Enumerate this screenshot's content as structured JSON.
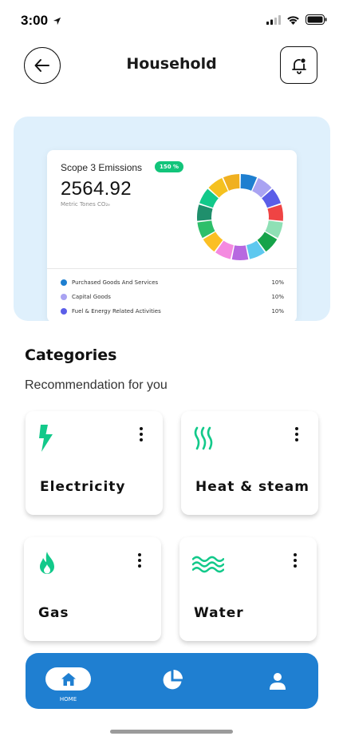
{
  "status_bar": {
    "time": "3:00"
  },
  "header": {
    "title": "Household"
  },
  "emissions": {
    "title": "Scope 3 Emissions",
    "badge": "150 %",
    "value": "2564.92",
    "unit": "Metric Tones CO₂ₑ",
    "segment_colors": [
      "#1e7fd0",
      "#a9a3f2",
      "#5b5ee8",
      "#ef4444",
      "#8fe0b5",
      "#16a34a",
      "#5ec8ef",
      "#b768e0",
      "#f48ae0",
      "#fbbf24",
      "#2ebf6a",
      "#1f8f6c",
      "#12c98a",
      "#f5c11f",
      "#f0b020"
    ],
    "legend": [
      {
        "label": "Purchased Goods And Services",
        "percent": "10%",
        "color": "#1e7fd0"
      },
      {
        "label": "Capital Goods",
        "percent": "10%",
        "color": "#a9a3f2"
      },
      {
        "label": "Fuel & Energy Related Activities",
        "percent": "10%",
        "color": "#5b5ee8"
      }
    ]
  },
  "categories": {
    "title": "Categories",
    "subtitle": "Recommendation for you",
    "accent": "#12c98a",
    "items": [
      {
        "label": "Electricity",
        "icon": "lightning-icon"
      },
      {
        "label": "Heat & steam",
        "icon": "heat-waves-icon"
      },
      {
        "label": "Gas",
        "icon": "flame-icon"
      },
      {
        "label": "Water",
        "icon": "water-waves-icon"
      }
    ]
  },
  "nav": {
    "home_label": "HOME",
    "color": "#1f7fd1",
    "items": [
      {
        "icon": "home-icon"
      },
      {
        "icon": "pie-chart-icon"
      },
      {
        "icon": "profile-icon"
      }
    ]
  }
}
